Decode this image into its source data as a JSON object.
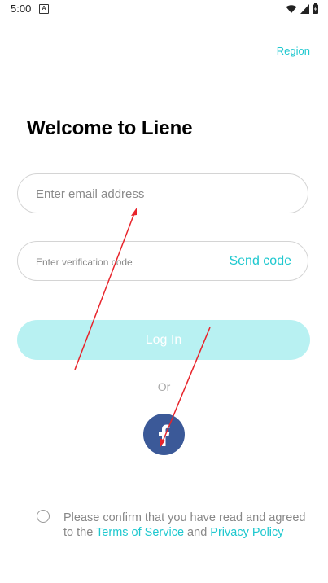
{
  "status_bar": {
    "time": "5:00",
    "notification_icon": "a-notification-icon",
    "icons": [
      "wifi-icon",
      "signal-icon",
      "battery-icon"
    ]
  },
  "header": {
    "region_label": "Region"
  },
  "main": {
    "title": "Welcome to Liene",
    "email_placeholder": "Enter email address",
    "email_value": "",
    "code_placeholder": "Enter verification code",
    "code_value": "",
    "send_code_label": "Send code",
    "login_label": "Log In",
    "or_label": "Or",
    "social_login_icon": "facebook-icon"
  },
  "consent": {
    "checked": false,
    "text_before": "Please confirm that you have read and agreed to the ",
    "terms_label": "Terms of Service",
    "text_and": " and ",
    "privacy_label": "Privacy Policy"
  },
  "colors": {
    "accent": "#1fc8cf",
    "login_disabled_bg": "#b8f1f2",
    "facebook_blue": "#3b5998",
    "annotation_red": "#e8242b"
  }
}
